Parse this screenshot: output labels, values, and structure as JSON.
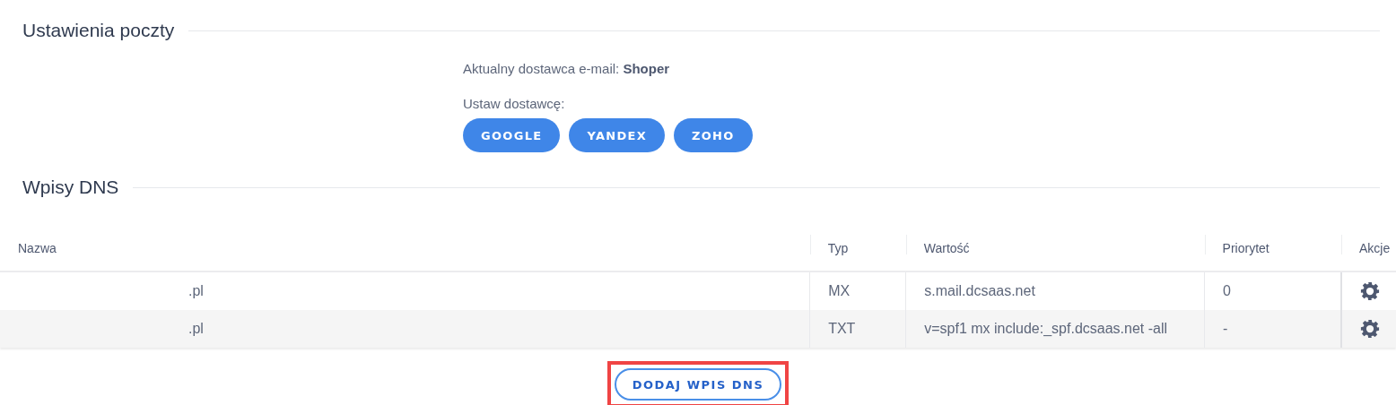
{
  "mail_settings": {
    "title": "Ustawienia poczty",
    "current_provider_label": "Aktualny dostawca e-mail:",
    "current_provider": "Shoper",
    "set_provider_label": "Ustaw dostawcę:",
    "provider_buttons": [
      "GOOGLE",
      "YANDEX",
      "ZOHO"
    ]
  },
  "dns": {
    "title": "Wpisy DNS",
    "columns": [
      "Nazwa",
      "Typ",
      "Wartość",
      "Priorytet",
      "Akcje"
    ],
    "rows": [
      {
        "name": ".pl",
        "type": "MX",
        "value": "s.mail.dcsaas.net",
        "priority": "0"
      },
      {
        "name": ".pl",
        "type": "TXT",
        "value": "v=spf1 mx include:_spf.dcsaas.net -all",
        "priority": "-"
      }
    ],
    "add_button": {
      "label": "DODAJ WPIS DNS",
      "highlighted": true
    }
  }
}
